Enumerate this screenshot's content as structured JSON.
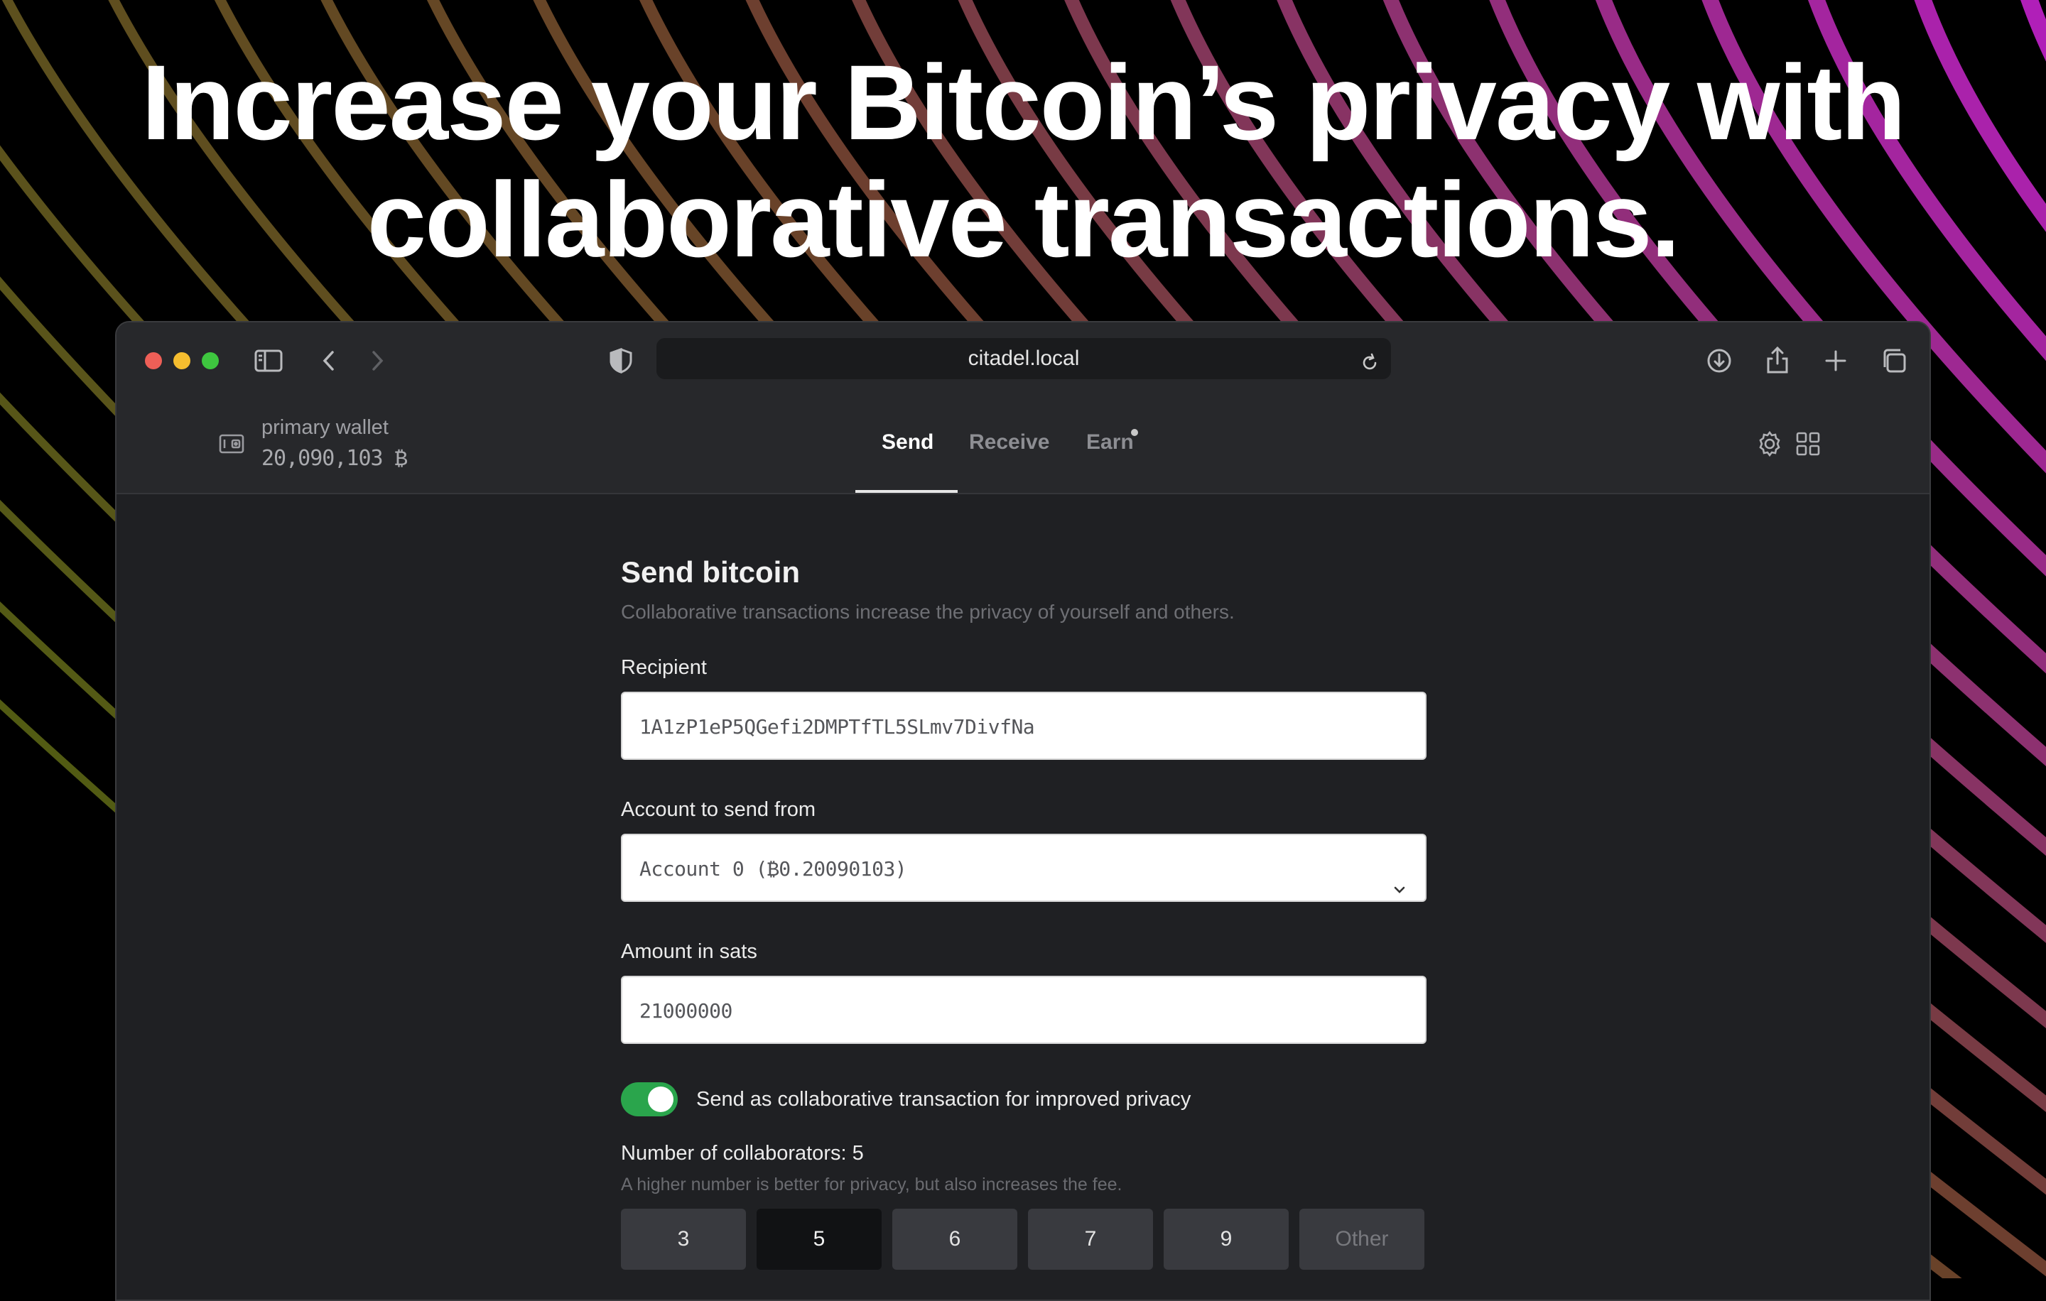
{
  "headline": {
    "line1": "Increase your Bitcoin’s privacy with",
    "line2": "collaborative transactions."
  },
  "browser": {
    "url": "citadel.local",
    "traffic_colors": [
      "#ee5f57",
      "#f5bd2f",
      "#3ec63f"
    ]
  },
  "header": {
    "wallet_name": "primary wallet",
    "wallet_balance": "20,090,103 ₿",
    "tabs": [
      {
        "label": "Send",
        "active": true
      },
      {
        "label": "Receive",
        "active": false
      },
      {
        "label": "Earn",
        "active": false
      }
    ]
  },
  "form": {
    "title": "Send bitcoin",
    "subtitle": "Collaborative transactions increase the privacy of yourself and others.",
    "recipient_label": "Recipient",
    "recipient_value": "1A1zP1eP5QGefi2DMPTfTL5SLmv7DivfNa",
    "account_label": "Account to send from",
    "account_value": "Account 0 (₿0.20090103)",
    "amount_label": "Amount in sats",
    "amount_value": "21000000",
    "collab_toggle_label": "Send as collaborative transaction for improved privacy",
    "collab_toggle_on": true,
    "collaborators_label": "Number of collaborators: 5",
    "collaborators_hint": "A higher number is better for privacy, but also increases the fee.",
    "collaborator_options": [
      "3",
      "5",
      "6",
      "7",
      "9",
      "Other"
    ],
    "selected_option": "5"
  },
  "colors": {
    "toggle_on": "#2aa54c",
    "background": "#000000",
    "app_bg": "#1f2023"
  }
}
